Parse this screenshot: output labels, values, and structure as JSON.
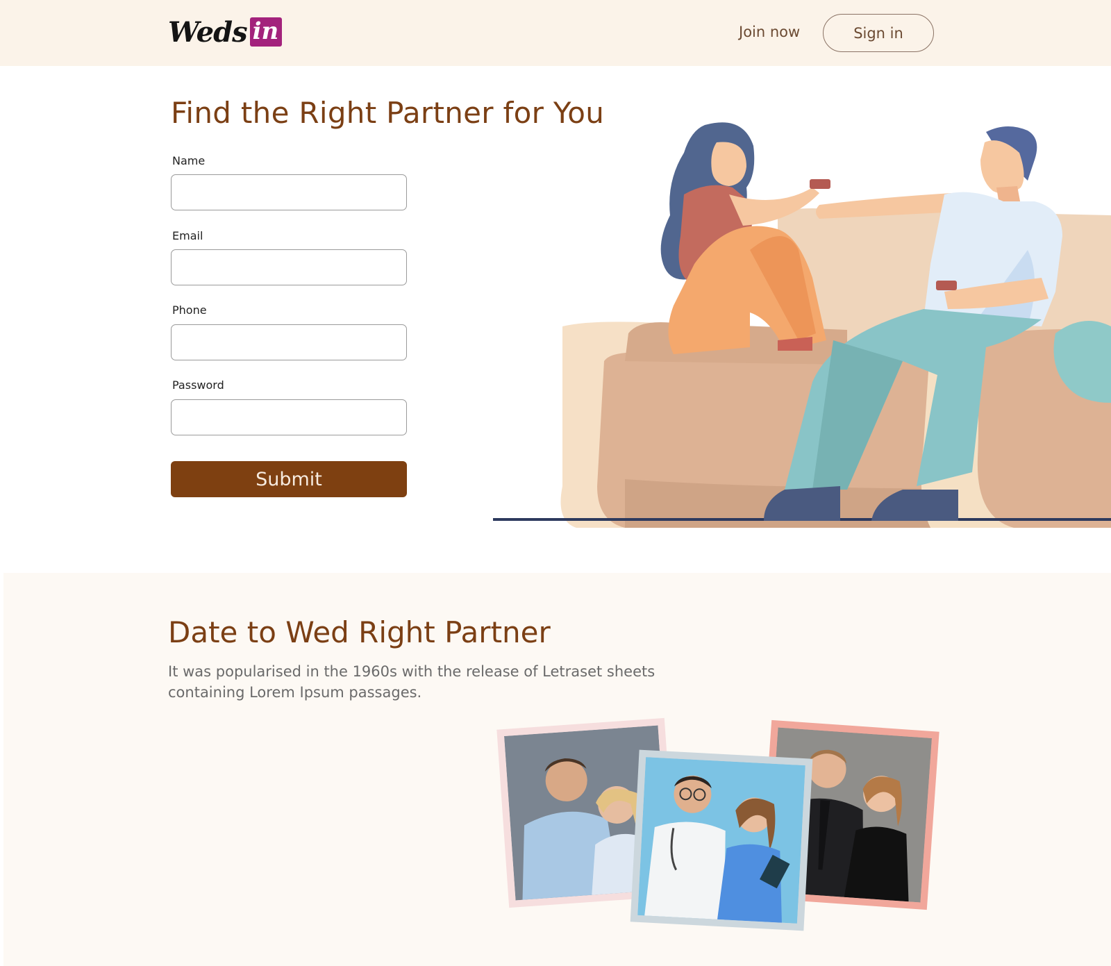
{
  "header": {
    "logo": {
      "part1": "Weds",
      "part2": "in"
    },
    "join_label": "Join now",
    "signin_label": "Sign in"
  },
  "hero": {
    "title": "Find the Right Partner for You",
    "form": {
      "name_label": "Name",
      "email_label": "Email",
      "phone_label": "Phone",
      "password_label": "Password",
      "submit_label": "Submit"
    }
  },
  "section2": {
    "title": "Date to Wed Right Partner",
    "text": "It was popularised in the 1960s with the release of Letraset sheets containing Lorem Ipsum passages."
  },
  "colors": {
    "header_bg": "#fbf3e9",
    "accent_brown": "#7e4011",
    "logo_magenta": "#a3227c",
    "section_bg": "#fdf9f4"
  }
}
